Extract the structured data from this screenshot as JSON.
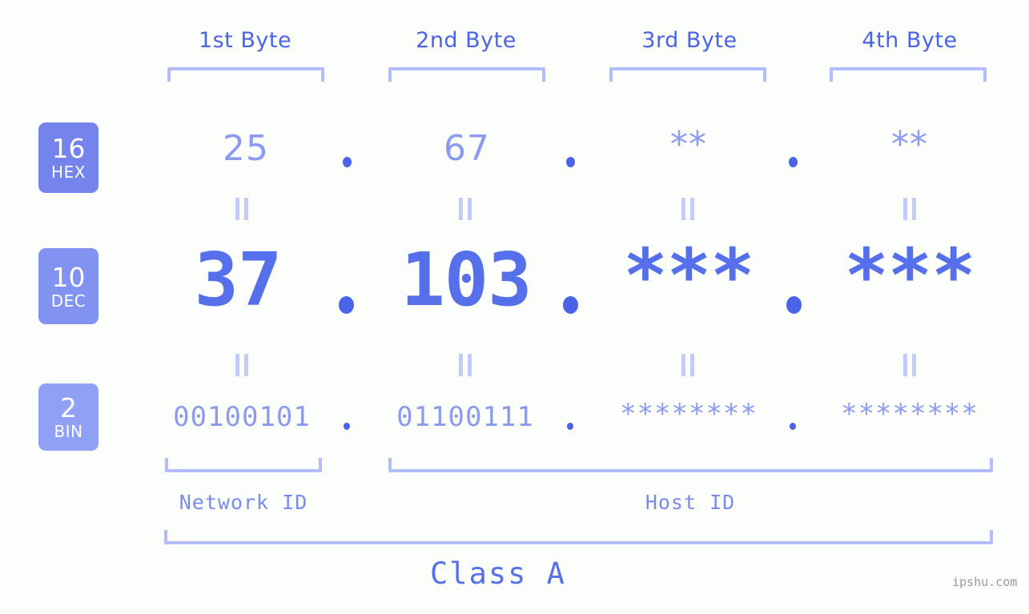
{
  "colors": {
    "background": "#fbfefb",
    "accent_dark": "#4a63e7",
    "accent_mid": "#5570ea",
    "accent_light": "#8c9af0",
    "bracket": "#b3bdfb",
    "badge_hex": "#7583ec",
    "badge_dec": "#8292f0",
    "badge_bin": "#8fa0f5",
    "watermark": "#9a9a9a"
  },
  "byte_headers": [
    {
      "label": "1st Byte"
    },
    {
      "label": "2nd Byte"
    },
    {
      "label": "3rd Byte"
    },
    {
      "label": "4th Byte"
    }
  ],
  "rows": [
    {
      "key": "hex",
      "badge_number": "16",
      "badge_abbr": "HEX",
      "values": [
        "25",
        "67",
        "**",
        "**"
      ],
      "separator": "."
    },
    {
      "key": "dec",
      "badge_number": "10",
      "badge_abbr": "DEC",
      "values": [
        "37",
        "103",
        "***",
        "***"
      ],
      "separator": "."
    },
    {
      "key": "bin",
      "badge_number": "2",
      "badge_abbr": "BIN",
      "values": [
        "00100101",
        "01100111",
        "********",
        "********"
      ],
      "separator": "."
    }
  ],
  "equals_marks": {
    "glyph": "||",
    "count_per_gap": 4
  },
  "segments": {
    "network_id": "Network ID",
    "host_id": "Host ID"
  },
  "class_label": "Class A",
  "watermark": "ipshu.com"
}
